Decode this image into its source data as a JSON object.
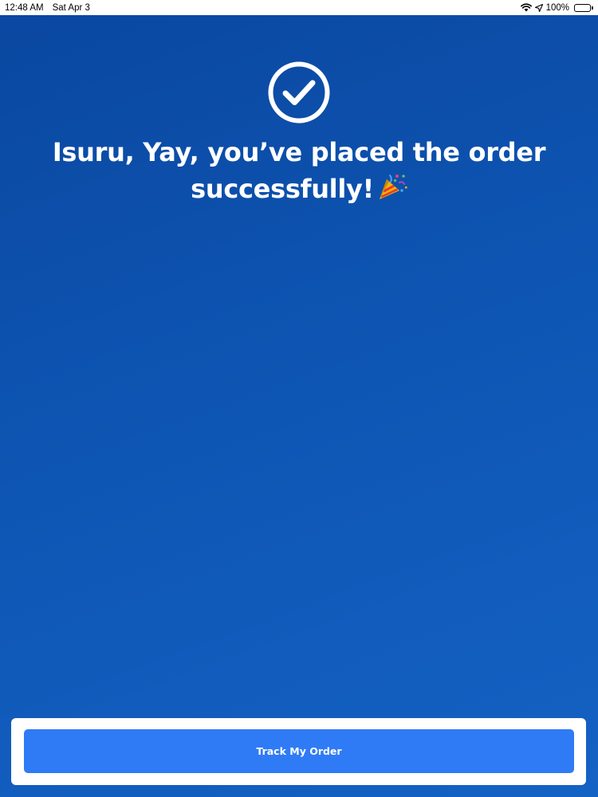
{
  "status_bar": {
    "time": "12:48 AM",
    "date": "Sat Apr 3",
    "battery_percent": "100%",
    "icons": [
      "wifi-icon",
      "location-arrow-icon",
      "battery-icon"
    ]
  },
  "confirmation": {
    "icon": "checkmark-circle-icon",
    "line1": "Isuru, Yay, you’ve placed the order",
    "line2": "successfully!",
    "emoji": "party-popper-icon"
  },
  "footer": {
    "track_button_label": "Track My Order"
  },
  "colors": {
    "background_top": "#0a47a0",
    "background_bottom": "#1462c4",
    "button": "#2f7bf6",
    "text": "#ffffff"
  }
}
